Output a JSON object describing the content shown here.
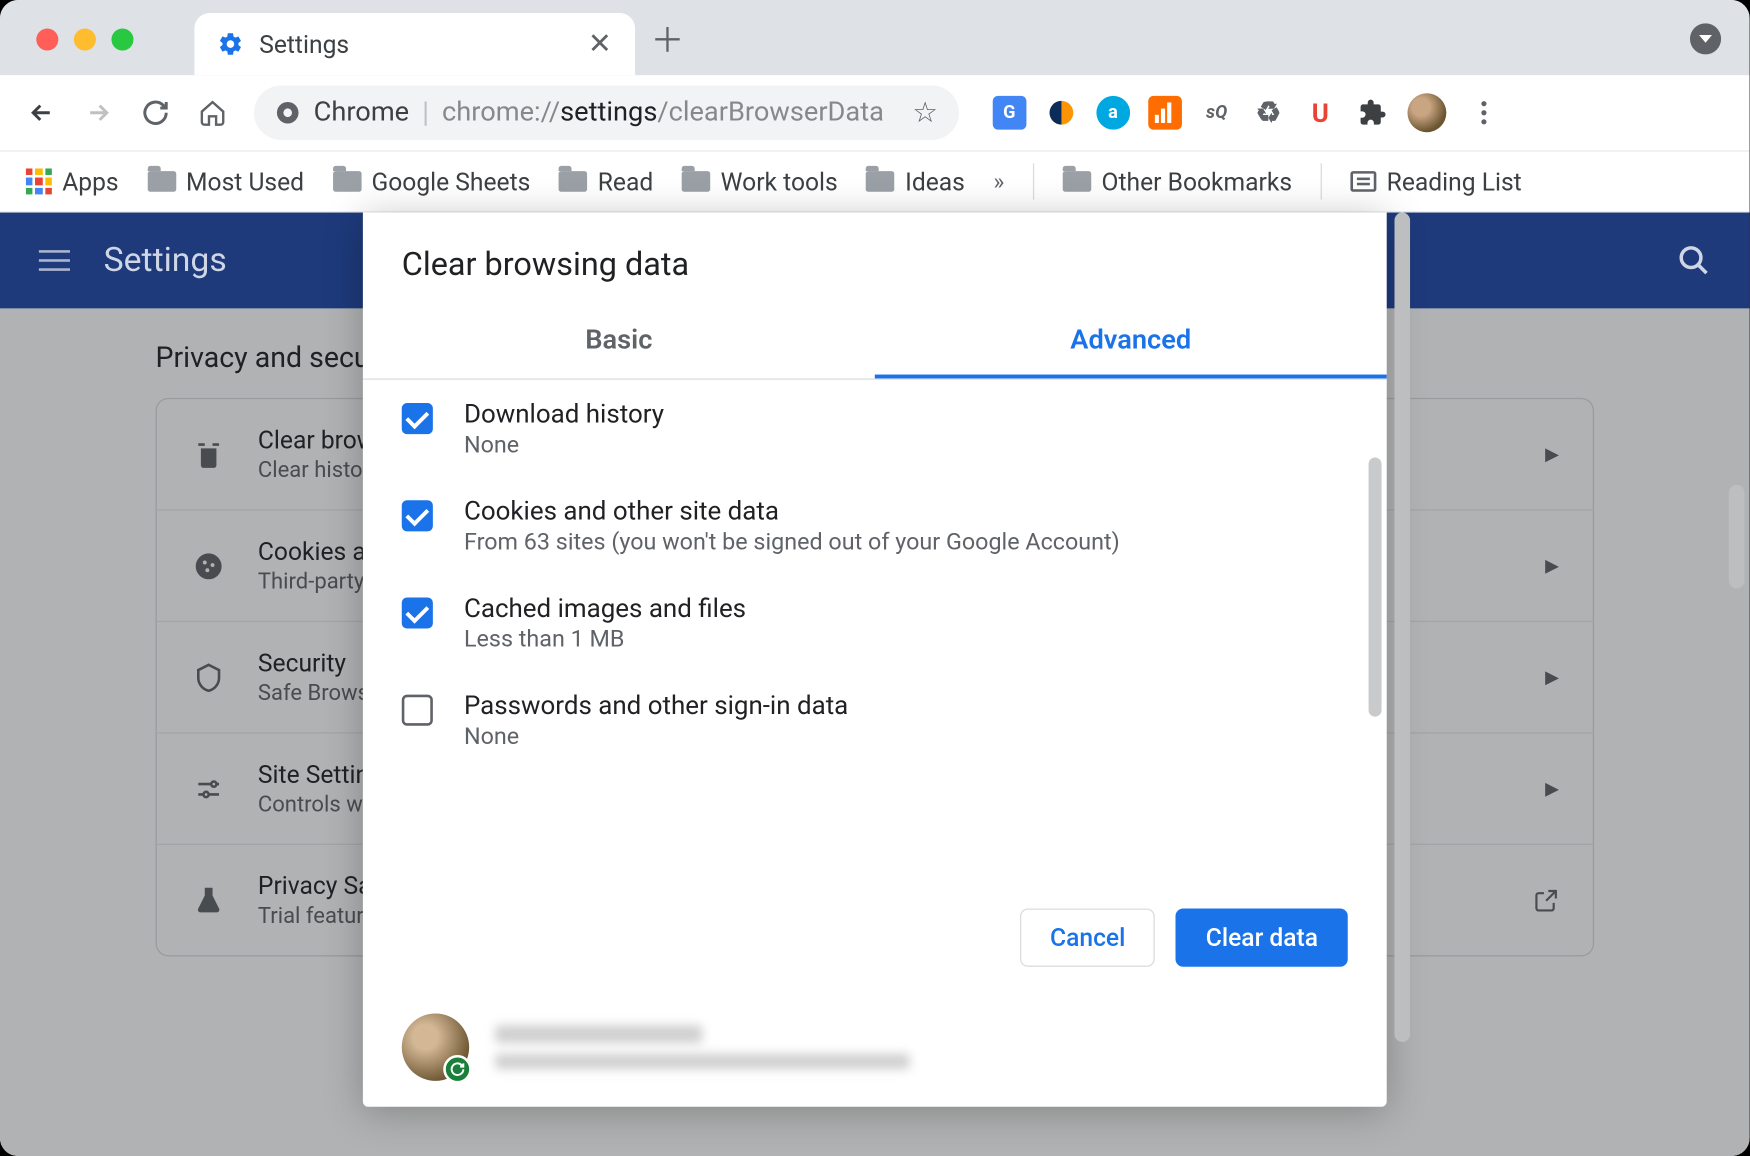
{
  "tab": {
    "title": "Settings"
  },
  "omnibox": {
    "label": "Chrome",
    "url_prefix": "chrome://",
    "url_bold": "settings",
    "url_suffix": "/clearBrowserData"
  },
  "bookmarks": {
    "apps": "Apps",
    "items": [
      "Most Used",
      "Google Sheets",
      "Read",
      "Work tools",
      "Ideas"
    ],
    "other": "Other Bookmarks",
    "reading": "Reading List"
  },
  "settings": {
    "header": "Settings",
    "section": "Privacy and security",
    "rows": [
      {
        "title": "Clear browsing data",
        "sub": "Clear history, cookies, cache, and more"
      },
      {
        "title": "Cookies and other site data",
        "sub": "Third-party cookies are blocked in Incognito mode"
      },
      {
        "title": "Security",
        "sub": "Safe Browsing (protection from dangerous sites) and other security settings"
      },
      {
        "title": "Site Settings",
        "sub": "Controls what information sites can use and show"
      },
      {
        "title": "Privacy Sandbox",
        "sub": "Trial features are on"
      }
    ]
  },
  "dialog": {
    "title": "Clear browsing data",
    "tabs": {
      "basic": "Basic",
      "advanced": "Advanced"
    },
    "options": [
      {
        "checked": true,
        "title": "Download history",
        "desc": "None"
      },
      {
        "checked": true,
        "title": "Cookies and other site data",
        "desc": "From 63 sites (you won't be signed out of your Google Account)"
      },
      {
        "checked": true,
        "title": "Cached images and files",
        "desc": "Less than 1 MB"
      },
      {
        "checked": false,
        "title": "Passwords and other sign-in data",
        "desc": "None"
      }
    ],
    "cancel": "Cancel",
    "confirm": "Clear data"
  }
}
